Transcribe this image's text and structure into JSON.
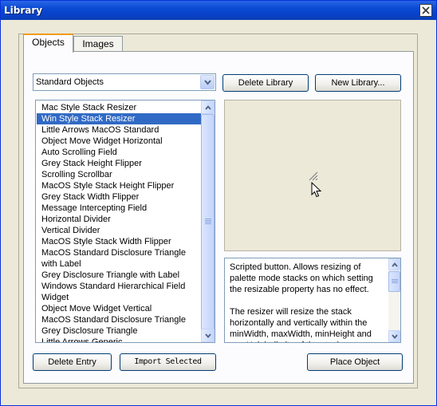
{
  "window": {
    "title": "Library"
  },
  "tabs": [
    {
      "label": "Objects",
      "active": true
    },
    {
      "label": "Images",
      "active": false
    }
  ],
  "category_select": {
    "value": "Standard Objects"
  },
  "buttons": {
    "delete_library": "Delete Library",
    "new_library": "New Library...",
    "delete_entry": "Delete Entry",
    "import_selected": "Import Selected",
    "place_object": "Place Object"
  },
  "object_list": {
    "selected_index": 1,
    "items": [
      "Mac Style Stack Resizer",
      "Win Style Stack Resizer",
      "Little Arrows MacOS Standard",
      "Object Move Widget Horizontal",
      "Auto Scrolling Field",
      "Grey Stack Height Flipper",
      "Scrolling Scrollbar",
      "MacOS Style Stack Height Flipper",
      "Grey Stack Width Flipper",
      "Message Intercepting Field",
      "Horizontal Divider",
      "Vertical Divider",
      "MacOS Style Stack Width Flipper",
      "MacOS Standard Disclosure Triangle",
      "with Label",
      "Grey Disclosure Triangle with Label",
      "Windows Standard Hierarchical Field",
      "Widget",
      "Object Move Widget Vertical",
      "MacOS Standard Disclosure Triangle",
      "Grey Disclosure Triangle",
      "Little Arrows Generic"
    ]
  },
  "description": {
    "text": "Scripted button. Allows resizing of palette mode stacks on which setting the resizable property has no effect.\n\nThe resizer will resize the stack horizontally and vertically within the minWidth, maxWidth, minHeight and maxHeight limits of the stack."
  },
  "icons": {
    "close": "close-icon",
    "dropdown": "chevron-down-icon",
    "scroll_up": "scroll-up-arrow-icon",
    "scroll_down": "scroll-down-arrow-icon",
    "resizer_preview": "resize-grip-icon",
    "cursor": "mouse-pointer-icon"
  },
  "colors": {
    "titlebar": "#0a4ad2",
    "selection": "#316ac5",
    "active_tab_accent": "#f29b10",
    "window_bg": "#ece9d8"
  }
}
